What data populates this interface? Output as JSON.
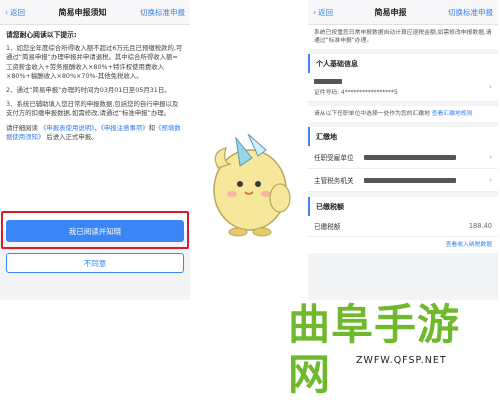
{
  "left": {
    "nav": {
      "back": "返回",
      "title": "简易申报须知",
      "right": "切换标准申报"
    },
    "heading": "请您耐心阅读以下提示:",
    "items": [
      "1、如您全年度综合所得收入额不超过6万元且已预缴税款的,可通过“简易申报”办理申报并申请退税。其中综合所得收入额=工资薪金收入+劳务报酬收入×80%+特许权使用费收入×80%+稿酬收入×80%×70%-其他免税收入。",
      "2、通过“简易申报”办理的时间为03月01日至05月31日。",
      "3、系统已辅助填入您日常的申报数据,包括您的自行申报以及支付方的扣缴申报数据,如需修改,请通过“标准申报”办理。"
    ],
    "read_prefix": "请仔细阅读",
    "read_links": [
      "《申报表使用说明》",
      "《申报注意事项》",
      "《预填数据使用须知》"
    ],
    "read_suffix": "后进入正式申报。",
    "confirm_button": "我已阅读并知晓",
    "decline_button": "不同意"
  },
  "right": {
    "nav": {
      "back": "返回",
      "title": "简易申报",
      "right": "切换标准申报"
    },
    "tip": "系统已按重您日常申报数据自动计算应退税金额,如需修改申报数据,请通过“标准申报”办理。",
    "basic_title": "个人基础信息",
    "id_label": "证件号码:",
    "id_value": "4*****************5",
    "unit_note": "请从以下任职单位中选择一处作为您的汇缴地",
    "unit_link": "查看汇缴地规则",
    "huijiao_title": "汇缴地",
    "employer_label": "任职受雇单位",
    "tax_office_label": "主管税务机关",
    "paid_title": "已缴税额",
    "paid_label": "已缴税额",
    "paid_value": "188.40",
    "paid_link": "查看收入纳税数据"
  },
  "watermark": {
    "brand": "曲阜手游网",
    "url": "ZWFW.QFSP.NET"
  },
  "colors": {
    "accent": "#3b86f6",
    "highlight": "#d91e2a",
    "brand": "#6fb92c"
  }
}
